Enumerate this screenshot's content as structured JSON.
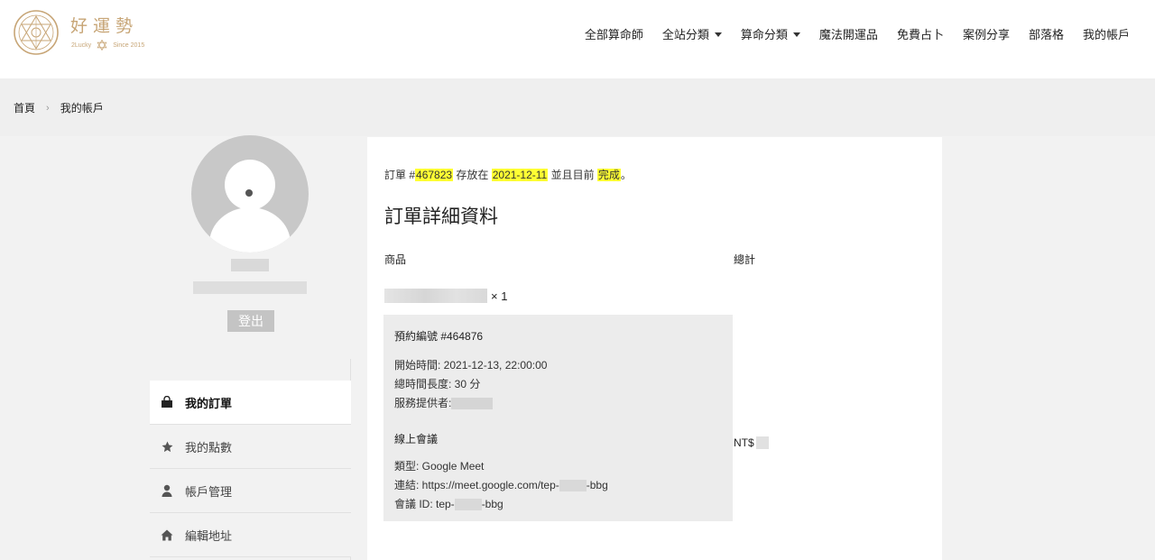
{
  "brand": {
    "name": "好運勢",
    "sub_left": "2Lucky",
    "sub_right": "Since 2015"
  },
  "nav": [
    {
      "label": "全部算命師",
      "dropdown": false
    },
    {
      "label": "全站分類",
      "dropdown": true
    },
    {
      "label": "算命分類",
      "dropdown": true
    },
    {
      "label": "魔法開運品",
      "dropdown": false
    },
    {
      "label": "免費占卜",
      "dropdown": false
    },
    {
      "label": "案例分享",
      "dropdown": false
    },
    {
      "label": "部落格",
      "dropdown": false
    },
    {
      "label": "我的帳戶",
      "dropdown": false
    }
  ],
  "breadcrumb": {
    "home": "首頁",
    "separator": "›",
    "current": "我的帳戶"
  },
  "profile": {
    "logout_label": "登出"
  },
  "menu": [
    {
      "label": "我的訂單",
      "icon": "shopping-bag-icon",
      "active": true
    },
    {
      "label": "我的點數",
      "icon": "star-icon",
      "active": false
    },
    {
      "label": "帳戶管理",
      "icon": "user-icon",
      "active": false
    },
    {
      "label": "編輯地址",
      "icon": "home-icon",
      "active": false
    }
  ],
  "order": {
    "prefix": "訂單 #",
    "number": "467823",
    "placed_text": " 存放在 ",
    "date": "2021-12-11",
    "status_text": " 並且目前 ",
    "status": "完成",
    "end": "。"
  },
  "details": {
    "title": "訂單詳細資料",
    "col_product": "商品",
    "col_total": "總計",
    "quantity": "× 1",
    "booking": {
      "title": "預約編號 #464876",
      "start": "開始時間: 2021-12-13, 22:00:00",
      "duration": "總時間長度: 30 分",
      "provider_label": "服務提供者:"
    },
    "meeting": {
      "title": "線上會議",
      "type": "類型: Google Meet",
      "link_prefix": "連結: https://meet.google.com/tep-",
      "link_suffix": "-bbg",
      "id_prefix": "會議 ID: tep-",
      "id_suffix": "-bbg"
    },
    "total_prefix": "NT$"
  },
  "colors": {
    "brand_gold": "#c7a576",
    "highlight": "#ffff33"
  }
}
